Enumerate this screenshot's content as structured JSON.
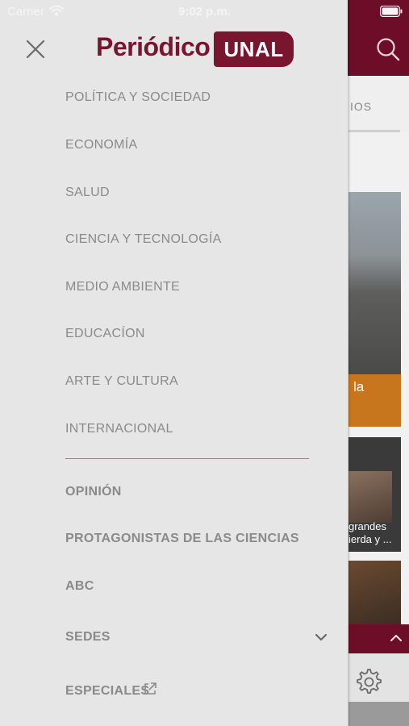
{
  "status_bar": {
    "carrier": "Carrier",
    "time": "9:02 p.m."
  },
  "header": {
    "logo_text": "Periódico",
    "logo_badge": "UNAL",
    "brand_color": "#7a1530"
  },
  "drawer": {
    "sections": [
      "POLÍTICA Y SOCIEDAD",
      "ECONOMÍA",
      "SALUD",
      "CIENCIA Y TECNOLOGÍA",
      "MEDIO AMBIENTE",
      "EDUCACÍON",
      "ARTE Y CULTURA",
      "INTERNACIONAL"
    ],
    "extra": {
      "opinion": "OPINIÓN",
      "protagonistas": "PROTAGONISTAS DE LAS CIENCIAS",
      "abc": "ABC",
      "sedes": "SEDES",
      "especiales": "ESPECIALES"
    }
  },
  "background": {
    "tab_fragment": "IOS",
    "card1_fragment": "la",
    "card2_line1": "grandes",
    "card2_line2": "ierda y ..."
  },
  "icons": {
    "close": "close-icon",
    "search": "search-icon",
    "settings": "gear-icon",
    "chevron_down": "chevron-down-icon",
    "chevron_up": "chevron-up-icon",
    "external": "external-link-icon",
    "wifi": "wifi-icon",
    "battery": "battery-icon"
  }
}
